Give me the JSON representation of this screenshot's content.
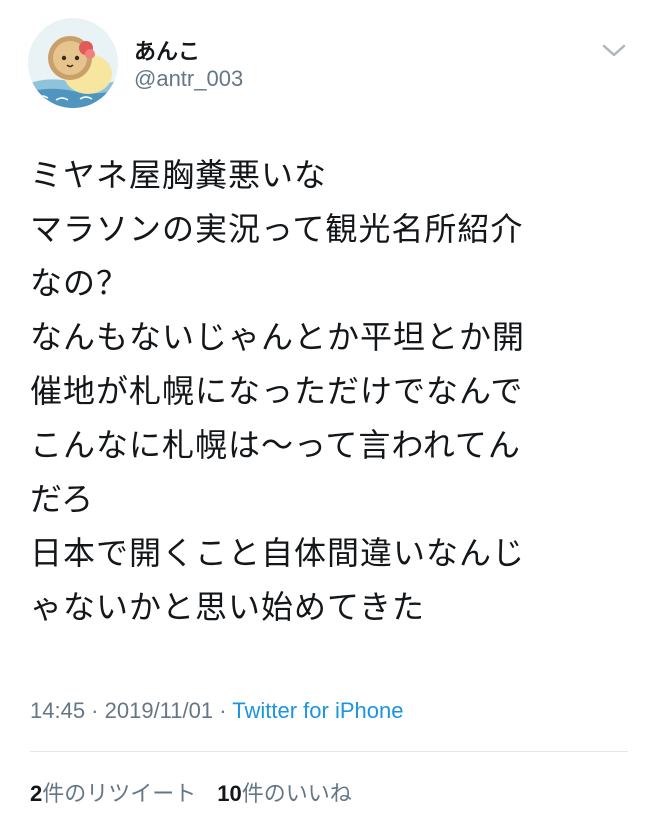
{
  "user": {
    "display_name": "あんこ",
    "handle": "@antr_003"
  },
  "tweet": {
    "lines": [
      "ミヤネ屋胸糞悪いな",
      "マラソンの実況って観光名所紹介",
      "なの？",
      "なんもないじゃんとか平坦とか開",
      "催地が札幌になっただけでなんで",
      "こんなに札幌は〜って言われてん",
      "だろ",
      "日本で開くこと自体間違いなんじ",
      "ゃないかと思い始めてきた"
    ]
  },
  "meta": {
    "time": "14:45",
    "separator": " · ",
    "date": "2019/11/01",
    "source": "Twitter for iPhone"
  },
  "stats": {
    "retweet_count": "2",
    "retweet_label": "件のリツイート",
    "like_count": "10",
    "like_label": "件のいいね"
  },
  "icons": {
    "caret": "chevron-down-icon",
    "avatar": "avatar-image"
  },
  "colors": {
    "text": "#14171a",
    "secondary": "#657786",
    "link": "#1b95e0",
    "divider": "#e1e8ed"
  }
}
